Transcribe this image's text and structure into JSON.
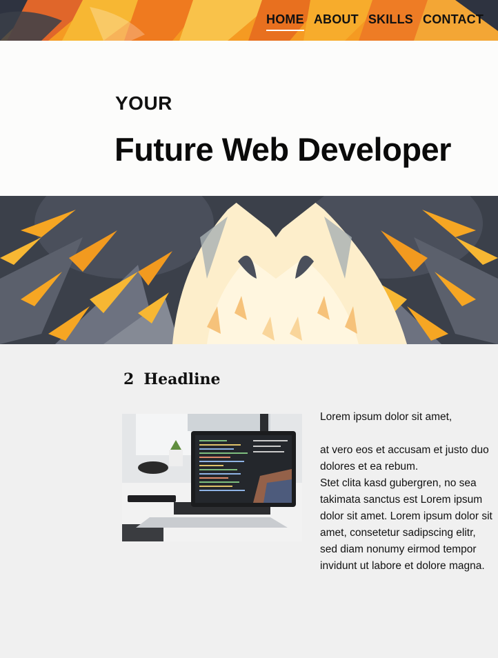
{
  "nav": {
    "items": [
      {
        "label": "HOME",
        "active": true
      },
      {
        "label": "ABOUT",
        "active": false
      },
      {
        "label": "SKILLS",
        "active": false
      },
      {
        "label": "CONTACT",
        "active": false
      }
    ]
  },
  "hero": {
    "eyebrow": "YOUR",
    "title": "Future Web Developer"
  },
  "section": {
    "number": "2",
    "headline": "Headline",
    "paragraph_1": "Lorem ipsum dolor sit amet,",
    "paragraph_2": "at vero eos et accusam et justo duo dolores et ea rebum.",
    "paragraph_3": "Stet clita kasd gubergren, no sea takimata sanctus est Lorem ipsum dolor sit amet. Lorem ipsum dolor sit amet, consetetur sadipscing elitr, sed diam nonumy eirmod tempor invidunt ut labore et dolore magna."
  },
  "colors": {
    "accent_orange": "#f28a1a",
    "dark_slate": "#3a3f49",
    "background": "#f0f0f0",
    "hero_background": "#fcfcfb"
  },
  "icons": {
    "header_art": "owl-feathers-art",
    "banner_art": "owl-illustration",
    "photo": "laptop-code-photo"
  }
}
